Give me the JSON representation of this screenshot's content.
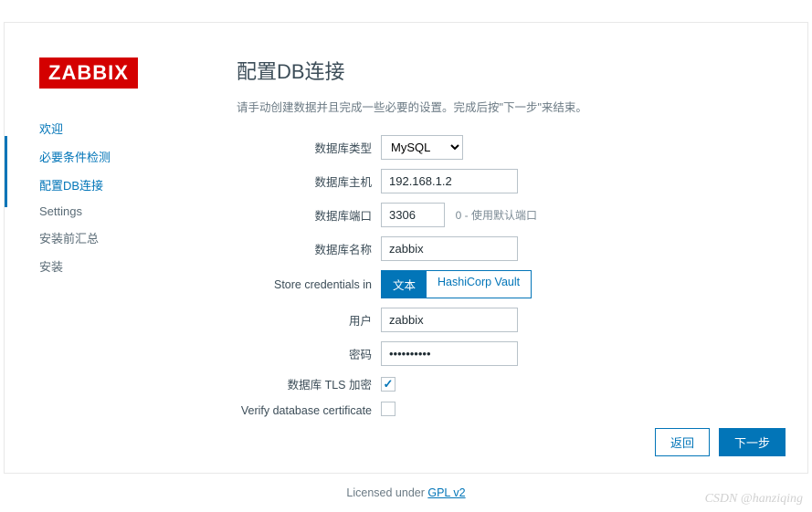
{
  "logo": "ZABBIX",
  "nav": {
    "items": [
      {
        "label": "欢迎"
      },
      {
        "label": "必要条件检测"
      },
      {
        "label": "配置DB连接"
      },
      {
        "label": "Settings"
      },
      {
        "label": "安装前汇总"
      },
      {
        "label": "安装"
      }
    ]
  },
  "main": {
    "title": "配置DB连接",
    "desc": "请手动创建数据并且完成一些必要的设置。完成后按\"下一步\"来结束。",
    "labels": {
      "db_type": "数据库类型",
      "db_host": "数据库主机",
      "db_port": "数据库端口",
      "db_name": "数据库名称",
      "store_cred": "Store credentials in",
      "user": "用户",
      "password": "密码",
      "tls": "数据库 TLS 加密",
      "verify": "Verify database certificate"
    },
    "values": {
      "db_type": "MySQL",
      "db_host": "192.168.1.2",
      "db_port": "3306",
      "db_name": "zabbix",
      "user": "zabbix",
      "password": "••••••••••"
    },
    "port_hint": "0 - 使用默认端口",
    "cred_options": {
      "plain": "文本",
      "vault": "HashiCorp Vault"
    }
  },
  "buttons": {
    "back": "返回",
    "next": "下一步"
  },
  "license": {
    "prefix": "Licensed under ",
    "link": "GPL v2"
  },
  "watermark": "CSDN @hanziqing"
}
